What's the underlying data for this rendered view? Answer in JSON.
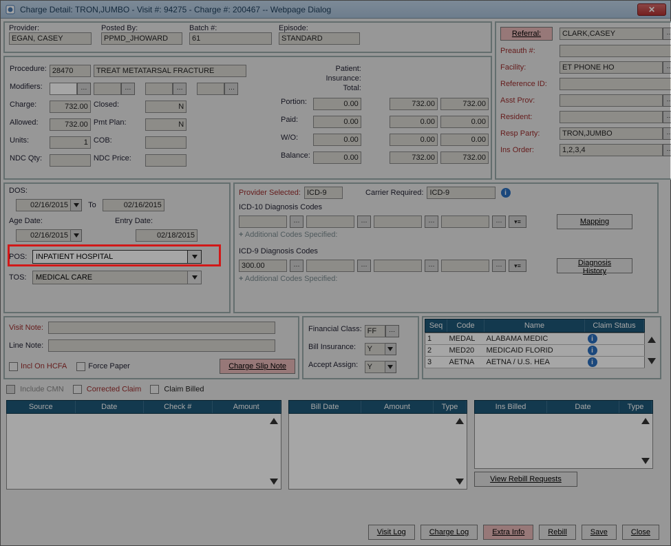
{
  "window": {
    "title": "Charge Detail: TRON,JUMBO - Visit #: 94275 - Charge #: 200467 -- Webpage Dialog"
  },
  "top": {
    "provider_lbl": "Provider:",
    "provider": "EGAN, CASEY",
    "postedby_lbl": "Posted By:",
    "postedby": "PPMD_JHOWARD",
    "batch_lbl": "Batch #:",
    "batch": "61",
    "episode_lbl": "Episode:",
    "episode": "STANDARD"
  },
  "right": {
    "referral_lbl": "Referral:",
    "referral": "CLARK,CASEY",
    "preauth_lbl": "Preauth #:",
    "preauth": "",
    "facility_lbl": "Facility:",
    "facility": "ET PHONE HO",
    "refid_lbl": "Reference ID:",
    "refid": "",
    "asst_lbl": "Asst Prov:",
    "asst": "",
    "resident_lbl": "Resident:",
    "resident": "",
    "resp_lbl": "Resp Party:",
    "resp": "TRON,JUMBO",
    "ins_lbl": "Ins Order:",
    "ins": "1,2,3,4"
  },
  "proc": {
    "procedure_lbl": "Procedure:",
    "procedure_code": "28470",
    "procedure_desc": "TREAT METATARSAL FRACTURE",
    "modifiers_lbl": "Modifiers:",
    "mod1": "",
    "charge_lbl": "Charge:",
    "charge": "732.00",
    "closed_lbl": "Closed:",
    "closed": "N",
    "allowed_lbl": "Allowed:",
    "allowed": "732.00",
    "pmtplan_lbl": "Pmt Plan:",
    "pmtplan": "N",
    "units_lbl": "Units:",
    "units": "1",
    "cob_lbl": "COB:",
    "cob": "",
    "ndcqty_lbl": "NDC Qty:",
    "ndcqty": "",
    "ndcprice_lbl": "NDC Price:",
    "ndcprice": ""
  },
  "fin_pane": {
    "patient_lbl": "Patient:",
    "insurance_lbl": "Insurance:",
    "total_lbl": "Total:",
    "portion_lbl": "Portion:",
    "paid_lbl": "Paid:",
    "wo_lbl": "W/O:",
    "balance_lbl": "Balance:",
    "portion": {
      "p": "0.00",
      "i": "732.00",
      "t": "732.00"
    },
    "paid": {
      "p": "0.00",
      "i": "0.00",
      "t": "0.00"
    },
    "wo": {
      "p": "0.00",
      "i": "0.00",
      "t": "0.00"
    },
    "balance": {
      "p": "0.00",
      "i": "732.00",
      "t": "732.00"
    }
  },
  "dates": {
    "dos_lbl": "DOS:",
    "dos_from": "02/16/2015",
    "to_lbl": "To",
    "dos_to": "02/16/2015",
    "age_lbl": "Age Date:",
    "age": "02/16/2015",
    "entry_lbl": "Entry Date:",
    "entry": "02/18/2015",
    "pos_lbl": "POS:",
    "pos": "INPATIENT HOSPITAL",
    "tos_lbl": "TOS:",
    "tos": "MEDICAL CARE"
  },
  "diag": {
    "provsel_lbl": "Provider Selected:",
    "provsel": "ICD-9",
    "carreq_lbl": "Carrier Required:",
    "carreq": "ICD-9",
    "icd10_lbl": "ICD-10 Diagnosis Codes",
    "icd9_lbl": "ICD-9 Diagnosis Codes",
    "icd9_1": "300.00",
    "addl_lbl": "Additional Codes Specified:",
    "mapping_btn": "Mapping",
    "diaghist_btn": "Diagnosis History"
  },
  "notes": {
    "visit_lbl": "Visit Note:",
    "line_lbl": "Line Note:",
    "incl_lbl": "Incl On HCFA",
    "force_lbl": "Force Paper",
    "slip_btn": "Charge Slip Note"
  },
  "bill": {
    "fc_lbl": "Financial Class:",
    "fc": "FF",
    "bi_lbl": "Bill Insurance:",
    "bi": "Y",
    "aa_lbl": "Accept Assign:",
    "aa": "Y"
  },
  "seq_tbl": {
    "hdr": {
      "seq": "Seq",
      "code": "Code",
      "name": "Name",
      "claim": "Claim Status"
    },
    "rows": [
      {
        "seq": "1",
        "code": "MEDAL",
        "name": "ALABAMA MEDIC"
      },
      {
        "seq": "2",
        "code": "MED20",
        "name": "MEDICAID FLORID"
      },
      {
        "seq": "3",
        "code": "AETNA",
        "name": "AETNA / U.S. HEA"
      }
    ]
  },
  "claims": {
    "cmn_lbl": "Include CMN",
    "corr_lbl": "Corrected Claim",
    "billed_lbl": "Claim Billed",
    "left_hdr": {
      "source": "Source",
      "date": "Date",
      "check": "Check #",
      "amount": "Amount"
    },
    "mid_hdr": {
      "bill": "Bill Date",
      "amount": "Amount",
      "type": "Type"
    },
    "right_hdr": {
      "billed": "Ins Billed",
      "date": "Date",
      "type": "Type"
    },
    "rebill_req": "View Rebill Requests"
  },
  "footer": {
    "visit": "Visit Log",
    "charge": "Charge Log",
    "extra": "Extra Info",
    "rebill": "Rebill",
    "save": "Save",
    "close": "Close"
  }
}
